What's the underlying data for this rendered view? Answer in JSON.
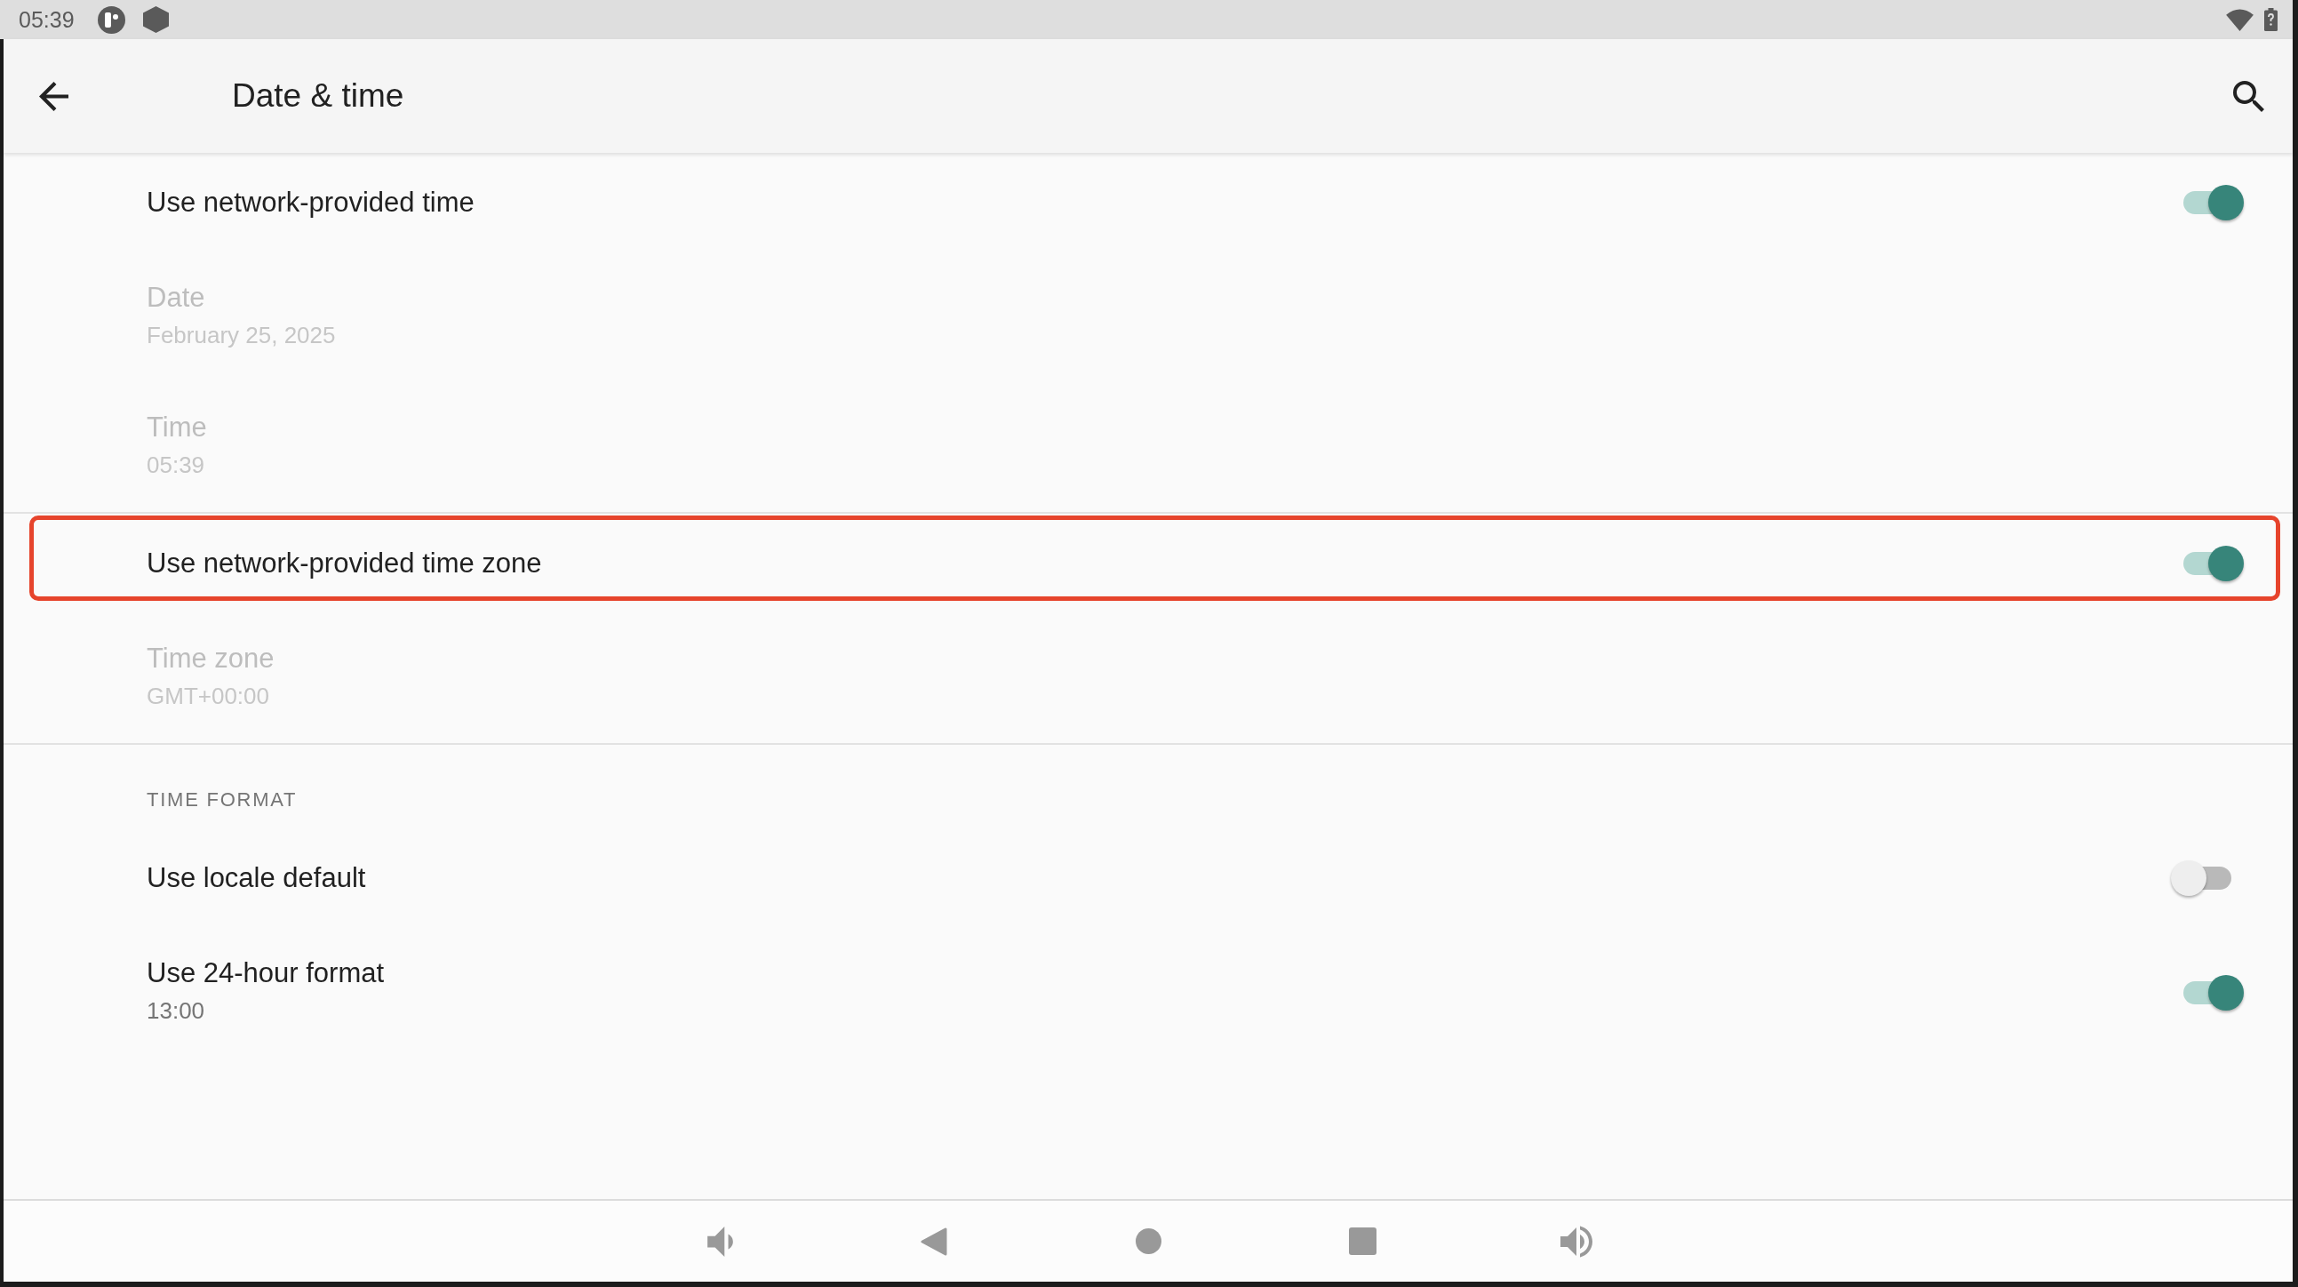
{
  "status_bar": {
    "time": "05:39"
  },
  "app_bar": {
    "title": "Date & time"
  },
  "sections": [
    {
      "items": [
        {
          "kind": "switch",
          "title": "Use network-provided time",
          "on": true,
          "disabled": false,
          "highlighted": false
        },
        {
          "kind": "text",
          "title": "Date",
          "summary": "February 25, 2025",
          "disabled": true,
          "highlighted": false
        },
        {
          "kind": "text",
          "title": "Time",
          "summary": "05:39",
          "disabled": true,
          "highlighted": false
        }
      ]
    },
    {
      "items": [
        {
          "kind": "switch",
          "title": "Use network-provided time zone",
          "on": true,
          "disabled": false,
          "highlighted": true
        },
        {
          "kind": "text",
          "title": "Time zone",
          "summary": "GMT+00:00",
          "disabled": true,
          "highlighted": false
        }
      ]
    },
    {
      "header": "TIME FORMAT",
      "items": [
        {
          "kind": "switch",
          "title": "Use locale default",
          "on": false,
          "disabled": false,
          "highlighted": false
        },
        {
          "kind": "switch",
          "title": "Use 24-hour format",
          "summary": "13:00",
          "on": true,
          "disabled": false,
          "highlighted": false
        }
      ]
    }
  ]
}
